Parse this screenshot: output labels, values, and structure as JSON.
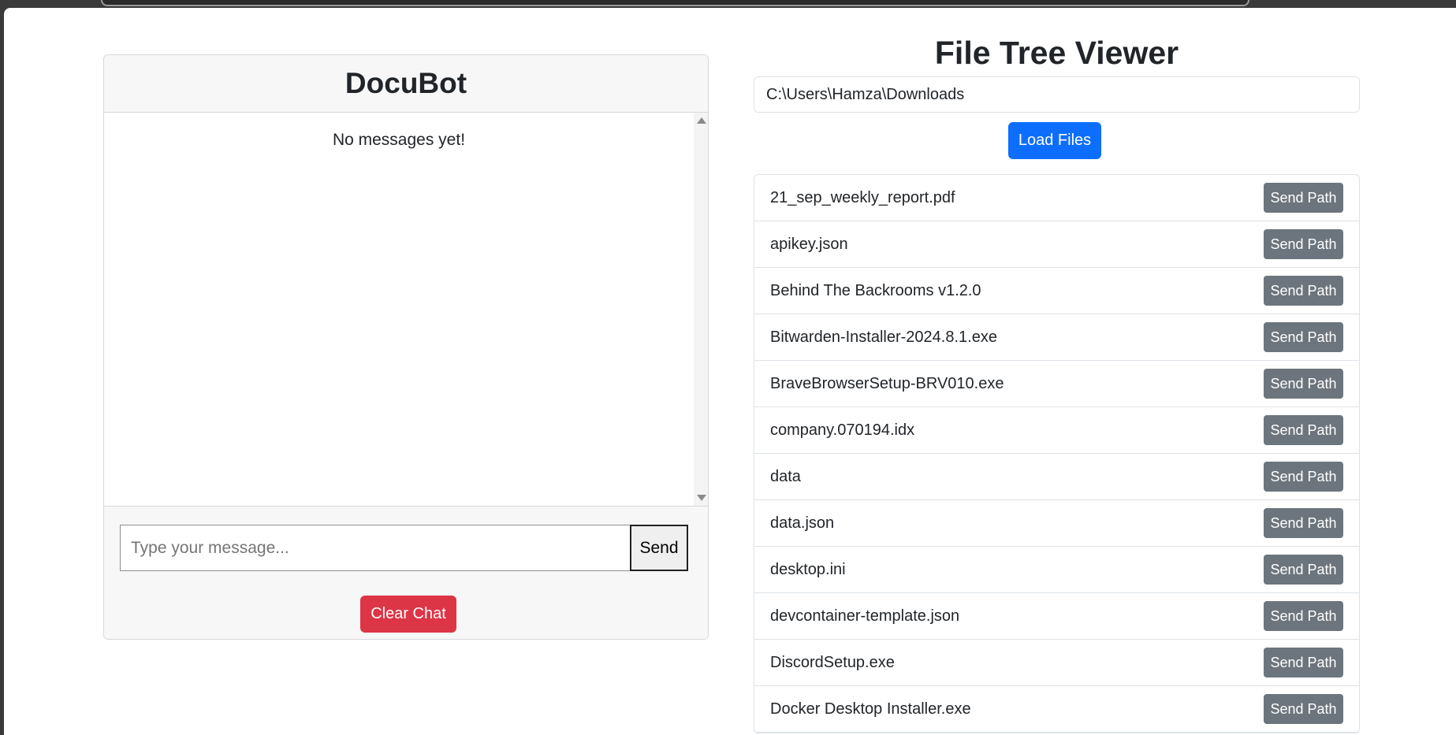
{
  "chat": {
    "title": "DocuBot",
    "empty_text": "No messages yet!",
    "input_placeholder": "Type your message...",
    "send_label": "Send",
    "clear_label": "Clear Chat"
  },
  "file_tree": {
    "title": "File Tree Viewer",
    "path_value": "C:\\Users\\Hamza\\Downloads",
    "load_label": "Load Files",
    "send_path_label": "Send Path",
    "files": [
      "21_sep_weekly_report.pdf",
      "apikey.json",
      "Behind The Backrooms v1.2.0",
      "Bitwarden-Installer-2024.8.1.exe",
      "BraveBrowserSetup-BRV010.exe",
      "company.070194.idx",
      "data",
      "data.json",
      "desktop.ini",
      "devcontainer-template.json",
      "DiscordSetup.exe",
      "Docker Desktop Installer.exe"
    ]
  }
}
